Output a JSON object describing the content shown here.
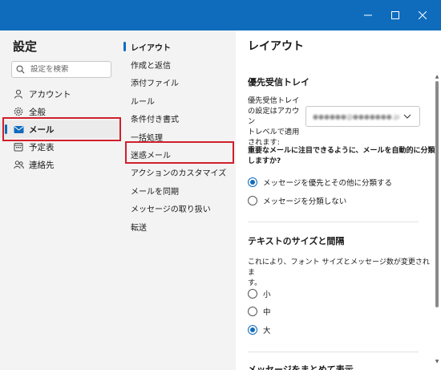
{
  "window": {
    "controls": {
      "minimize": "minimize",
      "maximize": "maximize",
      "close": "close"
    }
  },
  "sidebar": {
    "title": "設定",
    "search_placeholder": "設定を検索",
    "items": [
      {
        "label": "アカウント",
        "icon": "person-icon"
      },
      {
        "label": "全般",
        "icon": "gear-icon"
      },
      {
        "label": "メール",
        "icon": "mail-icon",
        "selected": true
      },
      {
        "label": "予定表",
        "icon": "calendar-icon"
      },
      {
        "label": "連絡先",
        "icon": "people-icon"
      }
    ]
  },
  "mail_menu": {
    "items": [
      {
        "label": "レイアウト",
        "selected": true
      },
      {
        "label": "作成と返信"
      },
      {
        "label": "添付ファイル"
      },
      {
        "label": "ルール"
      },
      {
        "label": "条件付き書式"
      },
      {
        "label": "一括処理"
      },
      {
        "label": "迷惑メール"
      },
      {
        "label": "アクションのカスタマイズ"
      },
      {
        "label": "メールを同期"
      },
      {
        "label": "メッセージの取り扱い"
      },
      {
        "label": "転送"
      }
    ]
  },
  "content": {
    "title": "レイアウト",
    "focused_inbox": {
      "title": "優先受信トレイ",
      "account_label_lines": [
        "優先受信トレイ",
        "の設定はアカウン",
        "トレベルで適用",
        "されます:"
      ],
      "account_value": "●●●●●●@●●●●●●●.jp",
      "question_lines": [
        "重要なメールに注目できるように、メールを自動的に分類",
        "しますか?"
      ],
      "options": [
        {
          "label": "メッセージを優先とその他に分類する",
          "checked": true
        },
        {
          "label": "メッセージを分類しない",
          "checked": false
        }
      ]
    },
    "text_size": {
      "title": "テキストのサイズと間隔",
      "description_lines": [
        "これにより、フォント サイズとメッセージ数が変更されま",
        "す。"
      ],
      "options": [
        {
          "label": "小",
          "checked": false
        },
        {
          "label": "中",
          "checked": false
        },
        {
          "label": "大",
          "checked": true
        }
      ]
    },
    "next_section_title": "メッセージをまとめて表示"
  },
  "colors": {
    "titlebar": "#0f6cbd",
    "accent": "#0f6cbd",
    "highlight": "#d0202c"
  }
}
